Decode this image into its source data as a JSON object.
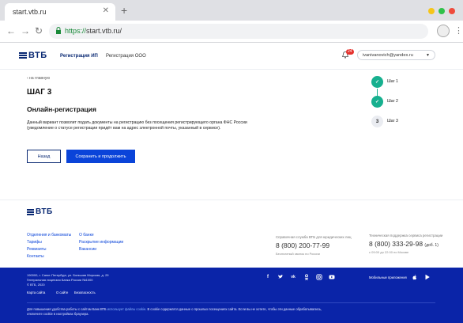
{
  "browser": {
    "tab_title": "start.vtb.ru",
    "tab_close": "✕",
    "new_tab": "+",
    "url_scheme": "https://",
    "url_rest": "start.vtb.ru/",
    "window_dot_colors": [
      "#f5c518",
      "#2fc14a",
      "#ef4b3c"
    ]
  },
  "header": {
    "logo_text": "ВТБ",
    "nav": [
      "Регистрация ИП",
      "Регистрация ООО"
    ],
    "notification_count": "24",
    "user_email": "ivanivanovich@yandex.ru"
  },
  "main": {
    "back_link": "‹  на главную",
    "step_title": "ШАГ 3",
    "section_title": "Онлайн-регистрация",
    "description": "Данный вариант позволит подать документы на регистрацию без посещения регистрирующего органа ФНС России (уведомление о статусе регистрации придёт вам на адрес электронной почты, указанный в сервисе).",
    "back_button": "Назад",
    "save_button": "Сохранить и продолжить"
  },
  "stepper": {
    "steps": [
      {
        "label": "Шаг 1",
        "mark": "✓"
      },
      {
        "label": "Шаг 2",
        "mark": "✓"
      },
      {
        "label": "Шаг 3",
        "mark": "3"
      }
    ]
  },
  "footer": {
    "logo_text": "ВТБ",
    "col1": [
      "Отделения и банкоматы",
      "Тарифы",
      "Реквизиты",
      "Контакты"
    ],
    "col2": [
      "О банке",
      "Раскрытие информации",
      "Вакансии"
    ],
    "support_legal_title": "Справочная служба ВТБ для юридических лиц",
    "support_legal_phone": "8 (800) 200-77-99",
    "support_legal_note": "Бесплатный звонок по России",
    "support_tech_title": "Техническая поддержка сервиса регистрации",
    "support_tech_phone": "8 (800) 333-29-98",
    "support_tech_ext": "(доб. 1)",
    "support_tech_note": "с 09:00 до 22:00 по Москве",
    "address": "190000, г. Санкт-Петербург, ул. Большая Морская, д. 29",
    "license": "Генеральная лицензия Банка России №1000",
    "copyright": "© ВТБ, 2020",
    "bottom_links": [
      "Карта сайта",
      "О сайте",
      "Безопасность"
    ],
    "social": [
      "f",
      "t",
      "vk",
      "ok",
      "ig",
      "yt"
    ],
    "mobile_apps": "Мобильные приложения",
    "legal_1": "Для повышения удобства работы с сайтом Банк ВТБ ",
    "legal_link": "использует файлы cookie",
    "legal_2": ". В cookie содержатся данные о прошлых посещениях сайта. Если вы не хотите, чтобы эти данные обрабатывались, отключите cookie в настройках браузера."
  }
}
